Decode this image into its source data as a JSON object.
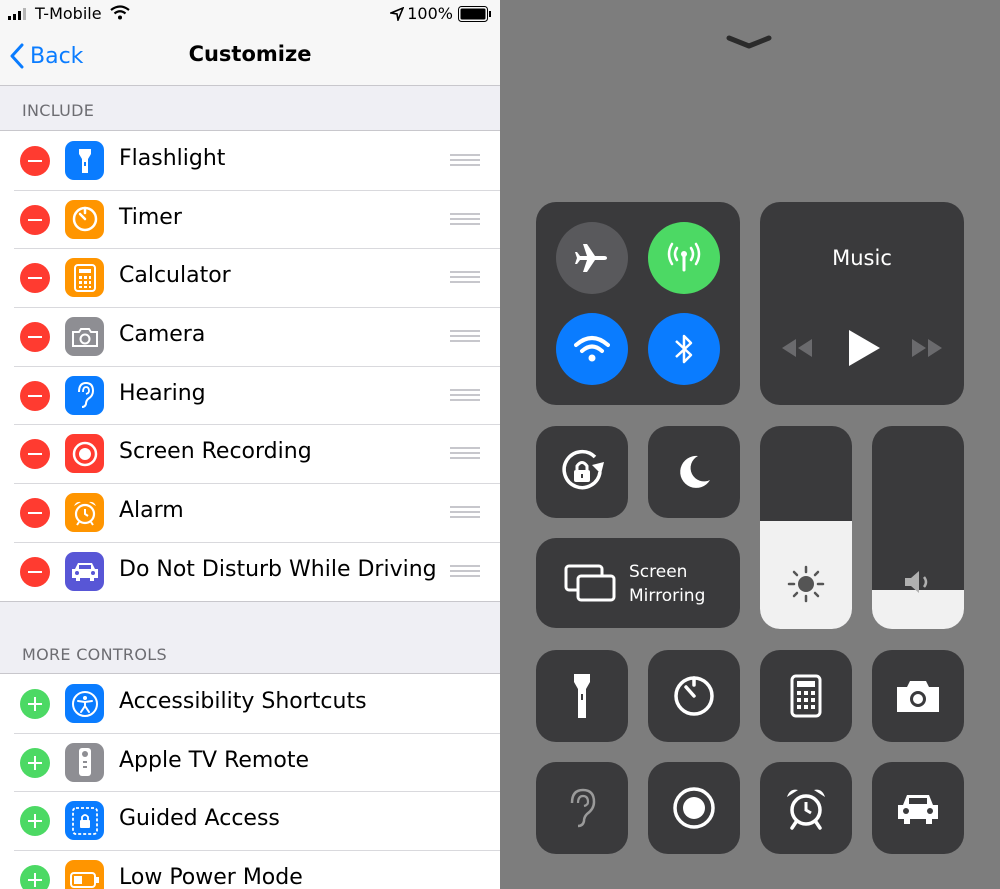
{
  "status_bar": {
    "carrier": "T-Mobile",
    "battery": "100%"
  },
  "nav": {
    "back": "Back",
    "title": "Customize"
  },
  "include": {
    "header": "INCLUDE",
    "items": [
      {
        "label": "Flashlight",
        "icon": "flashlight-icon",
        "color": "#0a7cff"
      },
      {
        "label": "Timer",
        "icon": "timer-icon",
        "color": "#ff9500"
      },
      {
        "label": "Calculator",
        "icon": "calculator-icon",
        "color": "#ff9500"
      },
      {
        "label": "Camera",
        "icon": "camera-icon",
        "color": "#8e8e93"
      },
      {
        "label": "Hearing",
        "icon": "ear-icon",
        "color": "#0a7cff"
      },
      {
        "label": "Screen Recording",
        "icon": "record-icon",
        "color": "#ff3b30"
      },
      {
        "label": "Alarm",
        "icon": "alarm-icon",
        "color": "#ff9500"
      },
      {
        "label": "Do Not Disturb While Driving",
        "icon": "car-icon",
        "color": "#5856d6"
      }
    ]
  },
  "more_controls": {
    "header": "MORE CONTROLS",
    "items": [
      {
        "label": "Accessibility Shortcuts",
        "icon": "accessibility-icon",
        "color": "#0a7cff"
      },
      {
        "label": "Apple TV Remote",
        "icon": "remote-icon",
        "color": "#8e8e93"
      },
      {
        "label": "Guided Access",
        "icon": "lock-icon",
        "color": "#0a7cff"
      },
      {
        "label": "Low Power Mode",
        "icon": "battery-icon",
        "color": "#ff9500"
      }
    ]
  },
  "control_center": {
    "music_label": "Music",
    "screen_mirroring": [
      "Screen",
      "Mirroring"
    ],
    "brightness_level": 0.53,
    "volume_level": 0.19,
    "colors": {
      "airplane": "#59595c",
      "cellular": "#4cd964",
      "wifi": "#0a7cff",
      "bluetooth": "#0a7cff"
    }
  }
}
